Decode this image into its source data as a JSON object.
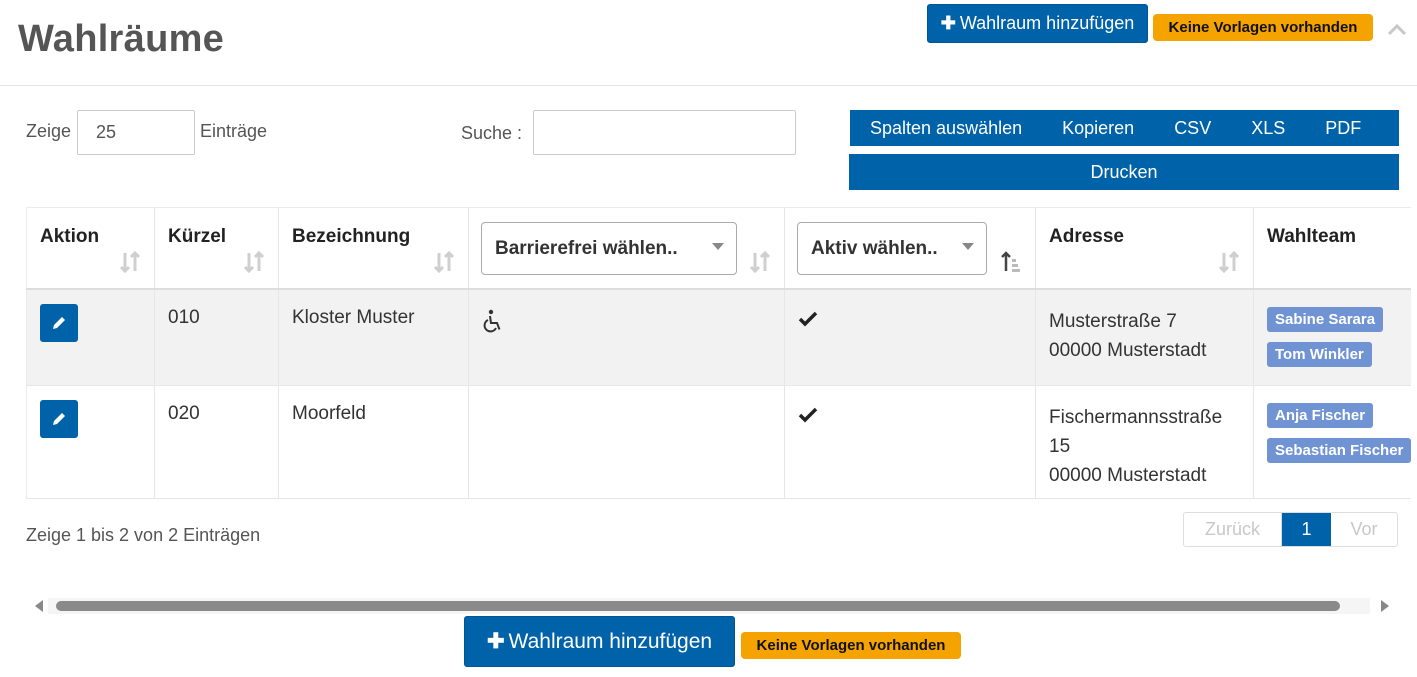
{
  "header": {
    "title": "Wahlräume",
    "add_button": "Wahlraum hinzufügen",
    "template_badge": "Keine Vorlagen vorhanden",
    "collapse_icon": "chevron-up-icon"
  },
  "controls": {
    "show_label": "Zeige",
    "page_length": "25",
    "entries_label": "Einträge",
    "search_label": "Suche :",
    "search_value": ""
  },
  "export": {
    "columns": "Spalten auswählen",
    "copy": "Kopieren",
    "csv": "CSV",
    "xls": "XLS",
    "pdf": "PDF",
    "print": "Drucken"
  },
  "table": {
    "columns": {
      "action": "Aktion",
      "code": "Kürzel",
      "name": "Bezeichnung",
      "accessible_filter": "Barrierefrei wählen..",
      "active_filter": "Aktiv wählen..",
      "address": "Adresse",
      "team": "Wahlteam"
    },
    "rows": [
      {
        "code": "010",
        "name": "Kloster Muster",
        "accessible_icon": "wheelchair-icon",
        "active_icon": "check-icon",
        "address_lines": [
          "Musterstraße 7",
          "00000 Musterstadt"
        ],
        "team": [
          "Sabine Sarara",
          "Tom Winkler"
        ]
      },
      {
        "code": "020",
        "name": "Moorfeld",
        "accessible_icon": "",
        "active_icon": "check-icon",
        "address_lines": [
          "Fischermannsstraße",
          "15",
          "00000 Musterstadt"
        ],
        "team": [
          "Anja Fischer",
          "Sebastian Fischer"
        ]
      }
    ]
  },
  "footer": {
    "info": "Zeige 1 bis 2 von 2 Einträgen",
    "prev": "Zurück",
    "current": "1",
    "next": "Vor"
  },
  "colors": {
    "primary": "#0062a8",
    "badge": "#f5a300",
    "tag": "#6f93d3"
  }
}
